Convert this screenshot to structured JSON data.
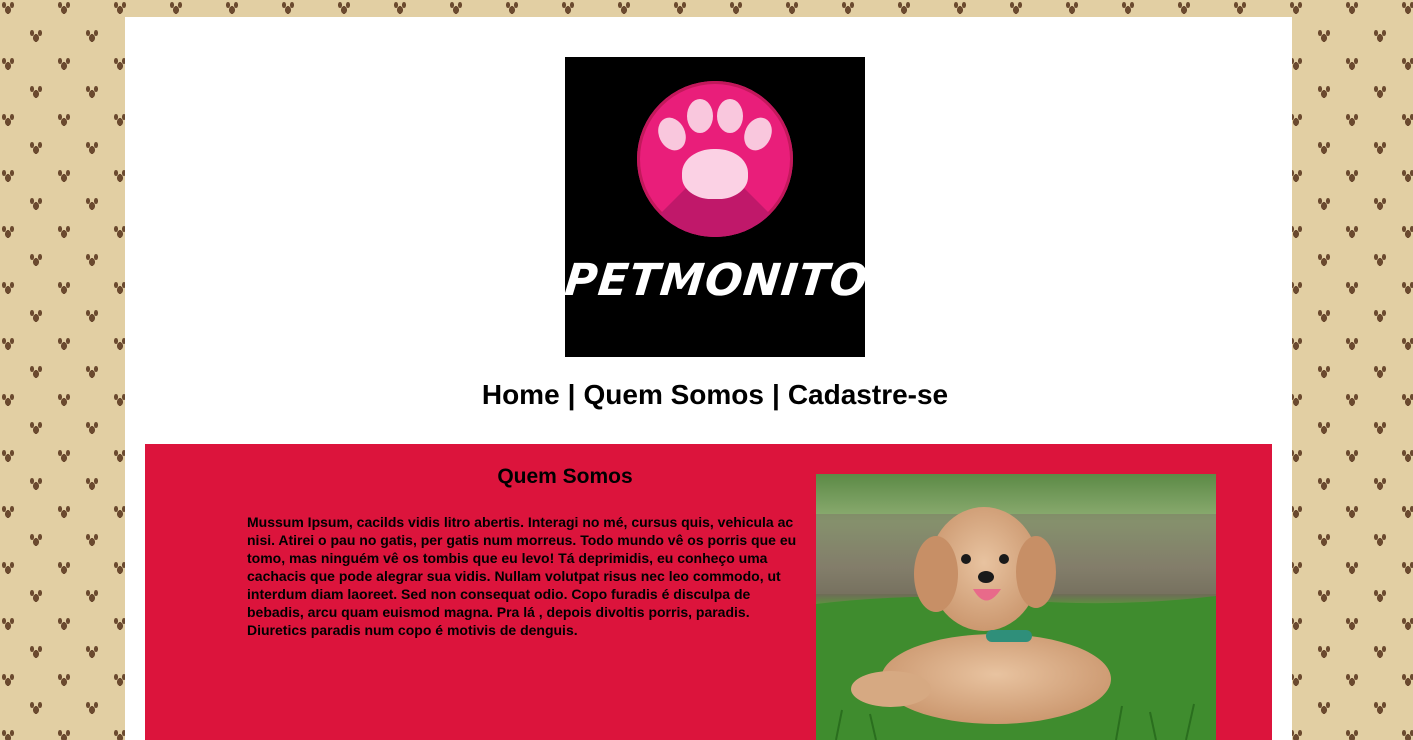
{
  "logo": {
    "brand_text": "PETMONITOR",
    "colors": {
      "background": "#000000",
      "circle": "#e91e7a",
      "paw": "#fbd1e4"
    }
  },
  "nav": {
    "items": [
      {
        "label": "Home"
      },
      {
        "label": "Quem Somos"
      },
      {
        "label": "Cadastre-se"
      }
    ],
    "separator": "|"
  },
  "section": {
    "title": "Quem Somos",
    "body": "Mussum Ipsum, cacilds vidis litro abertis. Interagi no mé, cursus quis, vehicula ac nisi. Atirei o pau no gatis, per gatis num morreus. Todo mundo vê os porris que eu tomo, mas ninguém vê os tombis que eu levo! Tá deprimidis, eu conheço uma cachacis que pode alegrar sua vidis. Nullam volutpat risus nec leo commodo, ut interdum diam laoreet. Sed non consequat odio. Copo furadis é disculpa de bebadis, arcu quam euismod magna. Pra lá , depois divoltis porris, paradis. Diuretics paradis num copo é motivis de denguis."
  },
  "photo": {
    "subject": "dog-photo"
  },
  "colors": {
    "page_background": "#e2cfa3",
    "paw_pattern": "#6b4a2f",
    "content_background": "#dc143c",
    "container": "#ffffff"
  }
}
